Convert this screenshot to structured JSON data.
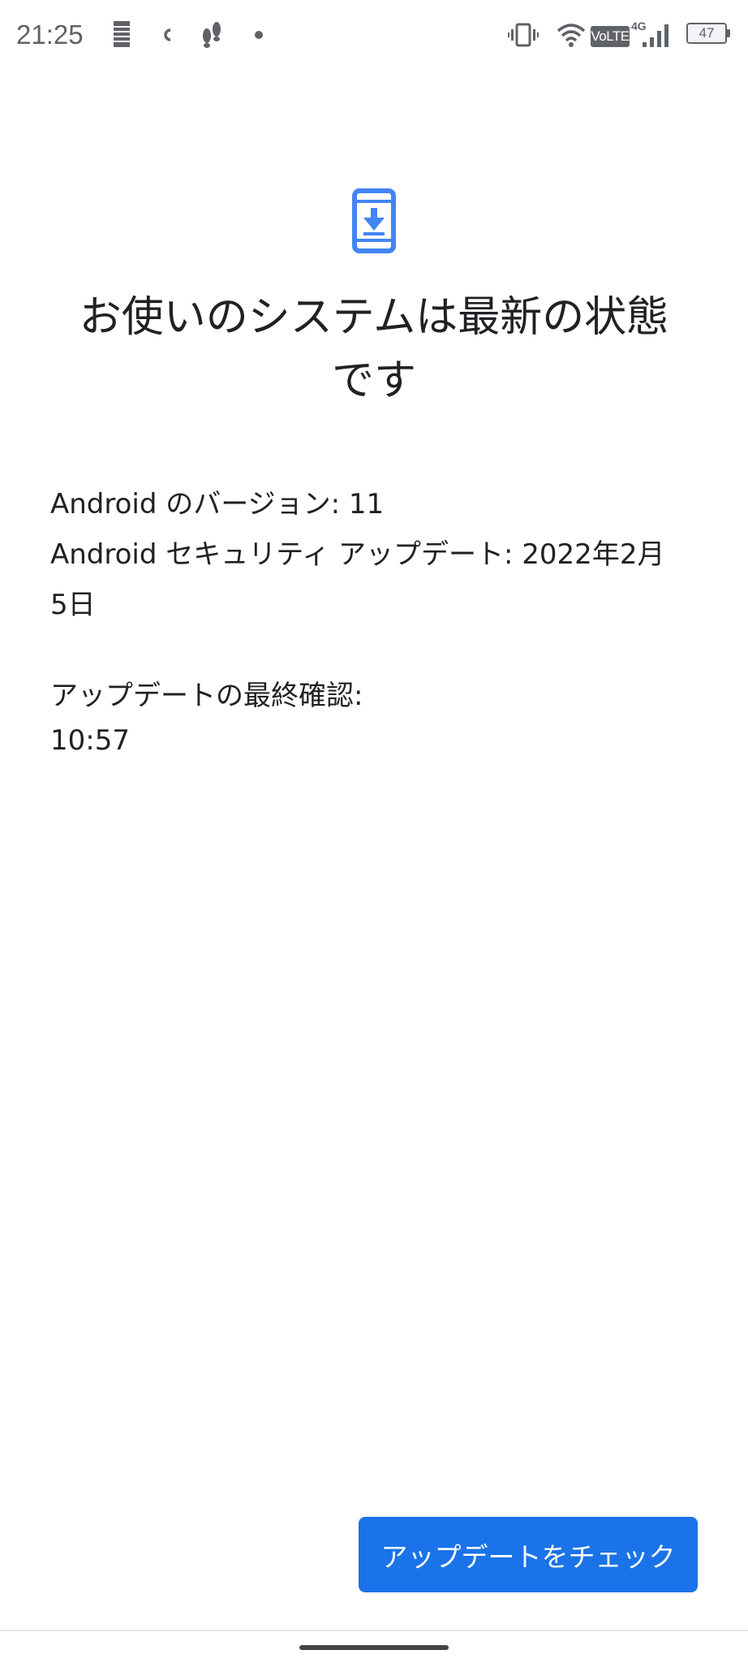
{
  "status_bar": {
    "time": "21:25",
    "network_label": "VoLTE",
    "network_gen": "4G",
    "battery_level": "47",
    "icons": [
      "notification-bars-icon",
      "c-icon",
      "footprints-icon",
      "dot-icon",
      "vibrate-icon",
      "wifi-icon",
      "volte-icon",
      "signal-icon",
      "battery-icon"
    ]
  },
  "main": {
    "icon": "phone-download-icon",
    "title_line1": "お使いのシステムは最新の状態",
    "title_line2": "です",
    "android_version": "Android のバージョン: 11",
    "security_update_line1": "Android セキュリティ アップデート: 2022年2月",
    "security_update_line2": "5日",
    "last_check_label": "アップデートの最終確認:",
    "last_check_time": "10:57"
  },
  "actions": {
    "check_button_label": "アップデートをチェック"
  },
  "colors": {
    "accent": "#1a73e8",
    "icon_blue": "#4285f4",
    "text": "#202124",
    "status_text": "#5f6368"
  }
}
